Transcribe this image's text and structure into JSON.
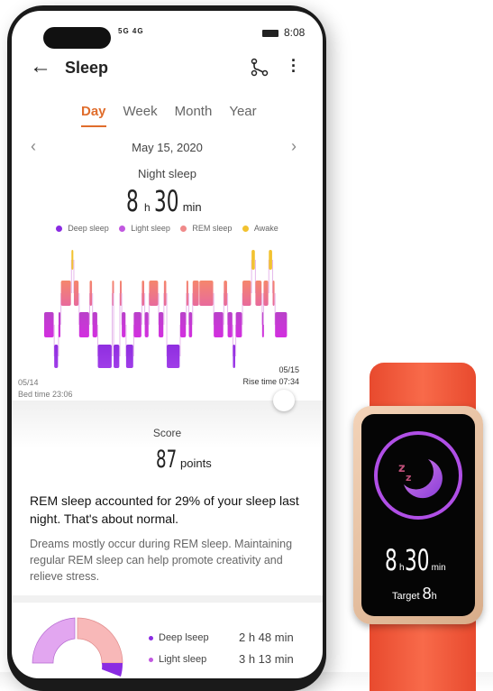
{
  "status_bar": {
    "signal": "5G 4G",
    "time": "8:08"
  },
  "header": {
    "title": "Sleep"
  },
  "tabs": [
    {
      "label": "Day",
      "active": true
    },
    {
      "label": "Week"
    },
    {
      "label": "Month"
    },
    {
      "label": "Year"
    }
  ],
  "date": "May 15, 2020",
  "summary": {
    "label": "Night sleep",
    "hours": "8",
    "h_unit": "h",
    "minutes": "30",
    "min_unit": "min"
  },
  "legend": [
    {
      "label": "Deep sleep",
      "color": "#8a2be2"
    },
    {
      "label": "Light sleep",
      "color": "#c158e0"
    },
    {
      "label": "REM sleep",
      "color": "#f08a8a"
    },
    {
      "label": "Awake",
      "color": "#f2c230"
    }
  ],
  "chart_data": {
    "type": "hypnogram",
    "stages": [
      "awake",
      "rem",
      "light",
      "deep"
    ],
    "segments_stage": [
      "light",
      "deep",
      "light",
      "rem",
      "awake",
      "rem",
      "light",
      "rem",
      "light",
      "deep",
      "rem",
      "deep",
      "rem",
      "light",
      "deep",
      "light",
      "rem",
      "light",
      "rem",
      "light",
      "rem",
      "deep",
      "light",
      "rem",
      "light",
      "rem",
      "rem",
      "light",
      "rem",
      "light",
      "deep",
      "light",
      "rem",
      "awake",
      "rem",
      "light",
      "rem",
      "awake",
      "rem",
      "light"
    ],
    "segments_minutes": [
      21,
      9,
      5,
      22,
      5,
      11,
      22,
      6,
      11,
      30,
      3,
      13,
      4,
      9,
      16,
      17,
      6,
      9,
      20,
      11,
      6,
      28,
      13,
      5,
      8,
      14,
      30,
      21,
      8,
      11,
      6,
      14,
      19,
      8,
      14,
      3,
      11,
      8,
      5,
      26
    ]
  },
  "chart_labels": {
    "start_date": "05/14",
    "bed_time": "Bed time 23:06",
    "end_date": "05/15",
    "rise_time": "Rise time 07:34"
  },
  "score": {
    "label": "Score",
    "value": "87",
    "unit": "points"
  },
  "insight": {
    "headline": "REM sleep accounted for 29% of your sleep last night. That's about normal.",
    "body": "Dreams mostly occur during REM sleep. Maintaining regular REM sleep can help promote creativity and relieve stress."
  },
  "breakdown": [
    {
      "label": "Deep lseep",
      "value": "2 h 48 min",
      "color": "#8a2be2"
    },
    {
      "label": "Light sleep",
      "value": "3 h 13 min",
      "color": "#c158e0"
    }
  ],
  "watch": {
    "hours": "8",
    "h_unit": "h",
    "minutes": "30",
    "min_unit": "min",
    "target_label": "Target",
    "target_value": "8",
    "target_unit": "h"
  }
}
